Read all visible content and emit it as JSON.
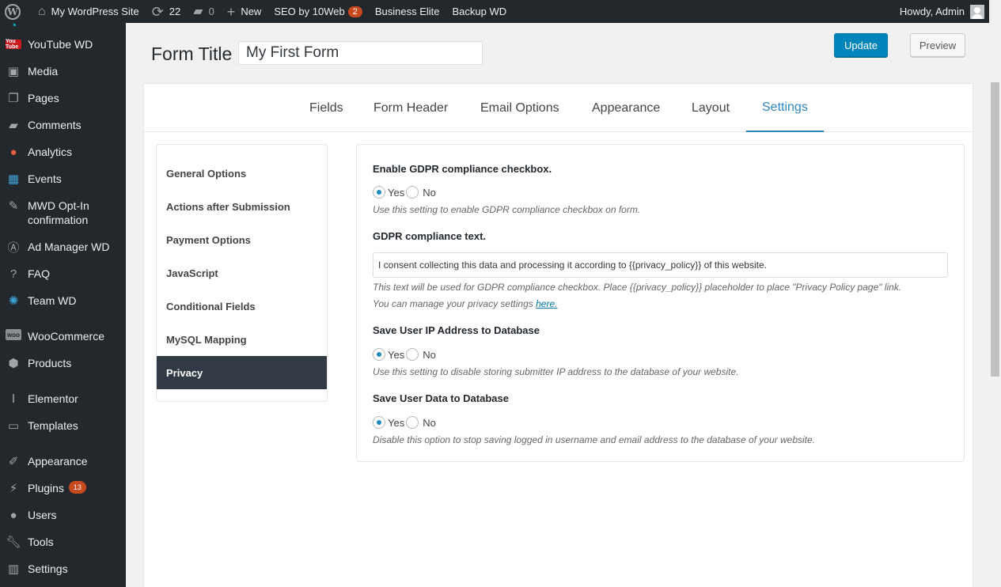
{
  "admin_bar": {
    "site_name": "My WordPress Site",
    "updates_count": "22",
    "comments_count": "0",
    "new_label": "New",
    "seo_label": "SEO by 10Web",
    "seo_count": "2",
    "business_label": "Business Elite",
    "backup_label": "Backup WD",
    "howdy": "Howdy, Admin"
  },
  "sidebar": {
    "items": [
      {
        "label": "YouTube WD",
        "icon": "youtube-icon"
      },
      {
        "label": "Media",
        "icon": "media-icon"
      },
      {
        "label": "Pages",
        "icon": "pages-icon"
      },
      {
        "label": "Comments",
        "icon": "comments-icon"
      },
      {
        "label": "Analytics",
        "icon": "analytics-icon"
      },
      {
        "label": "Events",
        "icon": "calendar-icon"
      },
      {
        "label": "MWD Opt-In confirmation",
        "icon": "pin-icon"
      },
      {
        "label": "Ad Manager WD",
        "icon": "ad-icon"
      },
      {
        "label": "FAQ",
        "icon": "question-icon"
      },
      {
        "label": "Team WD",
        "icon": "team-icon"
      },
      {
        "label": "WooCommerce",
        "icon": "woo-icon"
      },
      {
        "label": "Products",
        "icon": "box-icon"
      },
      {
        "label": "Elementor",
        "icon": "elementor-icon"
      },
      {
        "label": "Templates",
        "icon": "folder-icon"
      },
      {
        "label": "Appearance",
        "icon": "brush-icon"
      },
      {
        "label": "Plugins",
        "icon": "plugin-icon",
        "count": "13"
      },
      {
        "label": "Users",
        "icon": "user-icon"
      },
      {
        "label": "Tools",
        "icon": "wrench-icon"
      },
      {
        "label": "Settings",
        "icon": "settings-icon"
      }
    ]
  },
  "form": {
    "title_label": "Form Title",
    "title_value": "My First Form",
    "update_label": "Update",
    "preview_label": "Preview"
  },
  "tabs": [
    "Fields",
    "Form Header",
    "Email Options",
    "Appearance",
    "Layout",
    "Settings"
  ],
  "active_tab": "Settings",
  "side_nav": [
    "General Options",
    "Actions after Submission",
    "Payment Options",
    "JavaScript",
    "Conditional Fields",
    "MySQL Mapping",
    "Privacy"
  ],
  "active_side_nav": "Privacy",
  "privacy": {
    "gdpr_checkbox": {
      "title": "Enable GDPR compliance checkbox.",
      "yes": "Yes",
      "no": "No",
      "selected": "Yes",
      "description": "Use this setting to enable GDPR compliance checkbox on form."
    },
    "gdpr_text": {
      "title": "GDPR compliance text.",
      "value": "I consent collecting this data and processing it according to {{privacy_policy}} of this website.",
      "description": "This text will be used for GDPR compliance checkbox. Place {{privacy_policy}} placeholder to place \"Privacy Policy page\" link.",
      "manage_prefix": "You can manage your privacy settings ",
      "manage_link": "here."
    },
    "save_ip": {
      "title": "Save User IP Address to Database",
      "yes": "Yes",
      "no": "No",
      "selected": "Yes",
      "description": "Use this setting to disable storing submitter IP address to the database of your website."
    },
    "save_user_data": {
      "title": "Save User Data to Database",
      "yes": "Yes",
      "no": "No",
      "selected": "Yes",
      "description": "Disable this option to stop saving logged in username and email address to the database of your website."
    }
  },
  "colors": {
    "admin_bg": "#23282d",
    "accent": "#0085ba",
    "active_tab": "#2e86c1",
    "badge": "#ca4a1f",
    "active_nav_bg": "#323a45"
  }
}
